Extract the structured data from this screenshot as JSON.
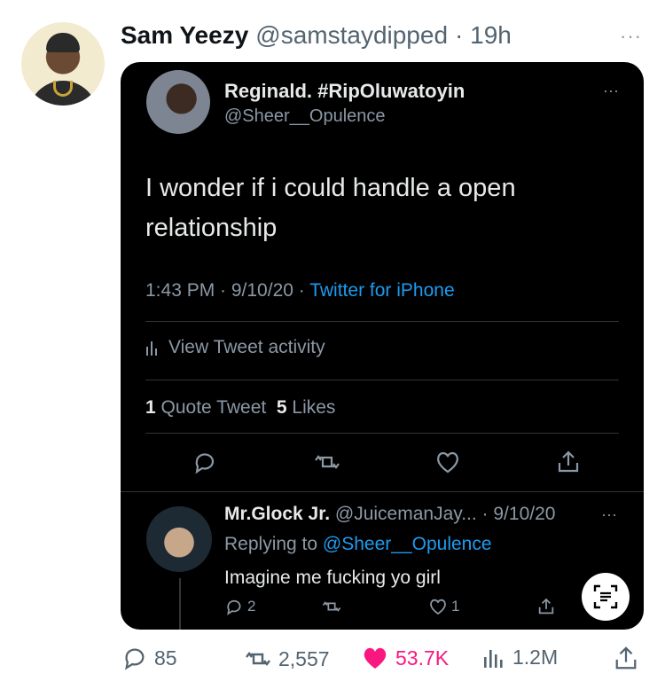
{
  "tweet": {
    "display_name": "Sam Yeezy",
    "handle": "@samstaydipped",
    "time": "· 19h",
    "more": "···"
  },
  "screenshot": {
    "quoted": {
      "name": "Reginald. #RipOluwatoyin",
      "handle": "@Sheer__Opulence",
      "more": "···",
      "text": "I wonder if i could handle a open relationship",
      "timestamp": "1:43 PM · 9/10/20 · ",
      "source": "Twitter for iPhone",
      "activity": "View Tweet activity",
      "quote_count": "1",
      "quote_label": " Quote Tweet  ",
      "like_count": "5",
      "like_label": " Likes"
    },
    "reply": {
      "name": "Mr.Glock Jr.",
      "handle_date": " @JuicemanJay... · 9/10/20",
      "more": "···",
      "replying_prefix": "Replying to ",
      "replying_to": "@Sheer__Opulence",
      "text": "Imagine me fucking yo girl",
      "reply_count": "2",
      "like_count": "1"
    }
  },
  "metrics": {
    "replies": "85",
    "retweets": "2,557",
    "likes": "53.7K",
    "views": "1.2M"
  },
  "colors": {
    "accent": "#1d9bf0",
    "like": "#f91880",
    "muted": "#536471"
  }
}
